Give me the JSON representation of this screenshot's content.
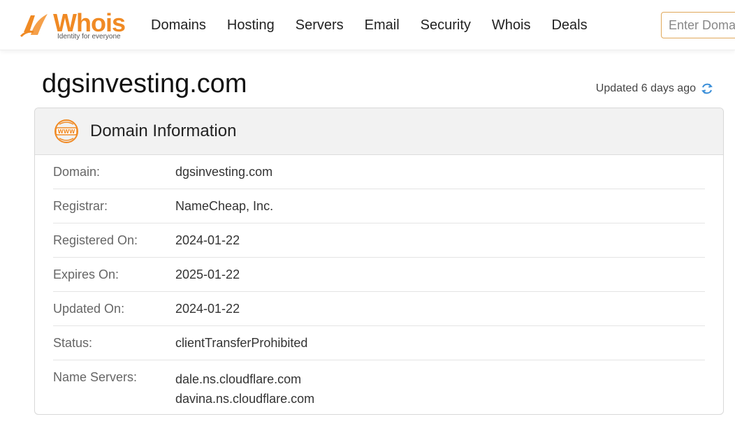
{
  "brand": {
    "name": "Whois",
    "tagline": "Identity for everyone",
    "accent": "#f08a24"
  },
  "nav": [
    "Domains",
    "Hosting",
    "Servers",
    "Email",
    "Security",
    "Whois",
    "Deals"
  ],
  "search": {
    "placeholder": "Enter Domain"
  },
  "page": {
    "title": "dgsinvesting.com",
    "updated": "Updated 6 days ago"
  },
  "card": {
    "icon": "www-icon",
    "title": "Domain Information",
    "rows": [
      {
        "label": "Domain:",
        "value": "dgsinvesting.com"
      },
      {
        "label": "Registrar:",
        "value": "NameCheap, Inc."
      },
      {
        "label": "Registered On:",
        "value": "2024-01-22"
      },
      {
        "label": "Expires On:",
        "value": "2025-01-22"
      },
      {
        "label": "Updated On:",
        "value": "2024-01-22"
      },
      {
        "label": "Status:",
        "value": "clientTransferProhibited"
      }
    ],
    "name_servers": {
      "label": "Name Servers:",
      "values": [
        "dale.ns.cloudflare.com",
        "davina.ns.cloudflare.com"
      ]
    }
  }
}
